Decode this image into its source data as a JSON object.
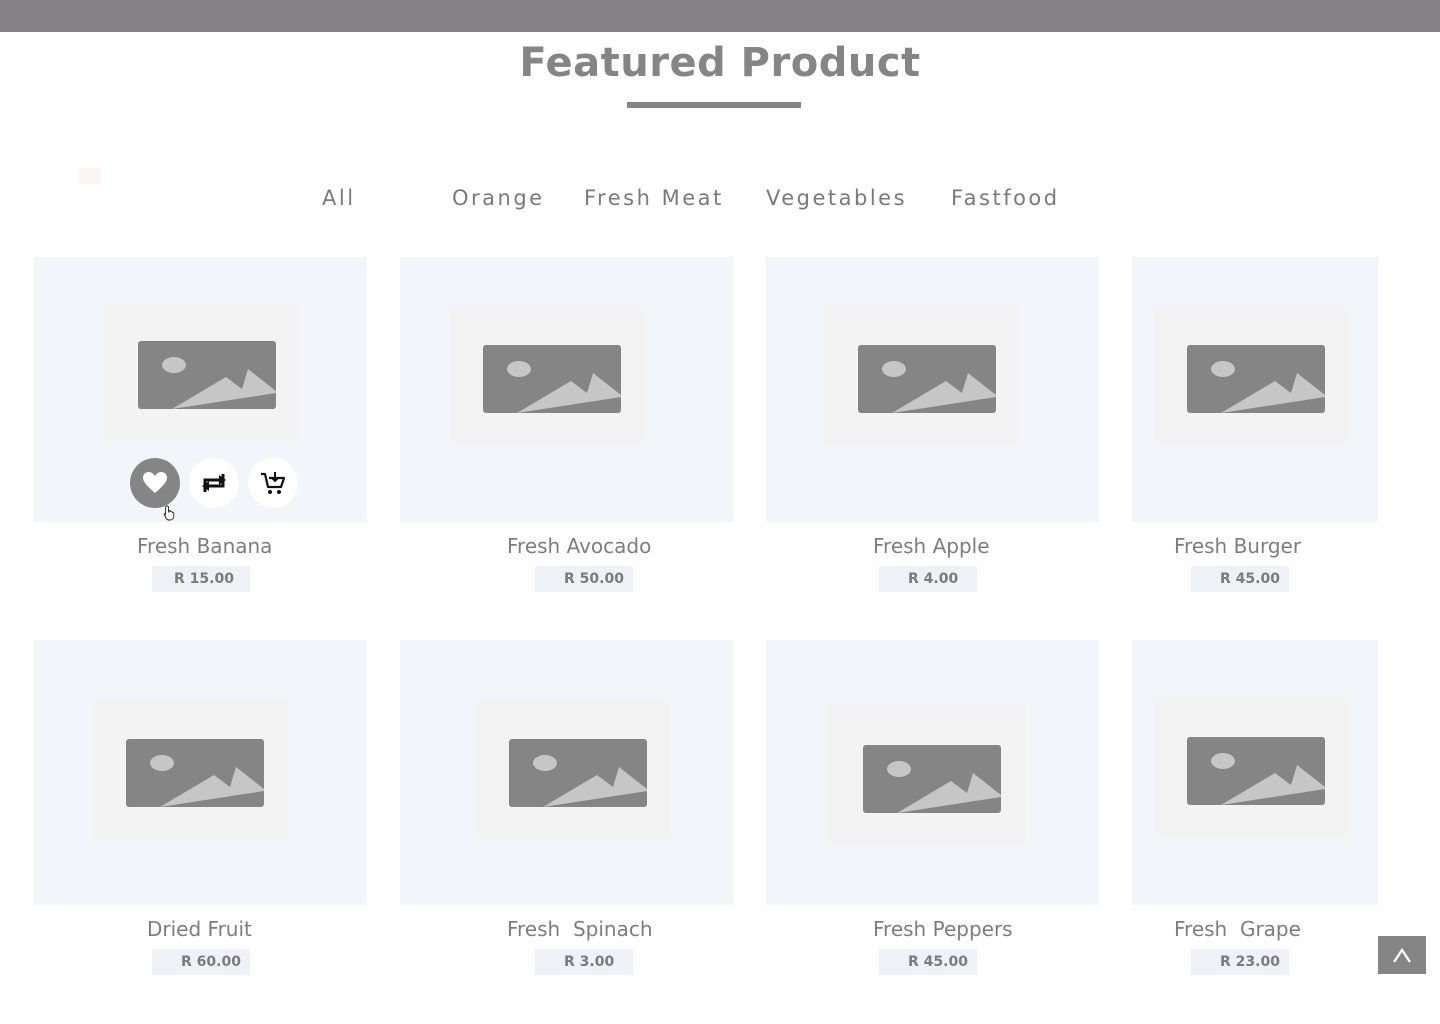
{
  "section": {
    "title": "Featured Product"
  },
  "filters": [
    {
      "label": "All"
    },
    {
      "label": "Orange"
    },
    {
      "label": "Fresh Meat"
    },
    {
      "label": "Vegetables"
    },
    {
      "label": "Fastfood"
    }
  ],
  "products": [
    {
      "name": "Fresh Banana",
      "price": "R 15.00"
    },
    {
      "name": "Fresh Avocado",
      "price": "R 50.00"
    },
    {
      "name": "Fresh Apple",
      "price": "R 4.00"
    },
    {
      "name": "Fresh Burger",
      "price": "R 45.00"
    },
    {
      "name": "Dried Fruit",
      "price": "R 60.00"
    },
    {
      "name": "Fresh  Spinach",
      "price": "R 3.00"
    },
    {
      "name": "Fresh Peppers",
      "price": "R 45.00"
    },
    {
      "name": "Fresh  Grape",
      "price": "R 23.00"
    }
  ],
  "card_actions": {
    "icons": [
      "heart-icon",
      "repeat-icon",
      "add-to-cart-icon"
    ],
    "active": "heart-icon"
  },
  "colors": {
    "topbar": "#858385",
    "title": "#858585",
    "card_bg": "#f3f5fa",
    "accent_gray": "#858585"
  },
  "scroll_top": {
    "icon": "chevron-up-icon"
  }
}
